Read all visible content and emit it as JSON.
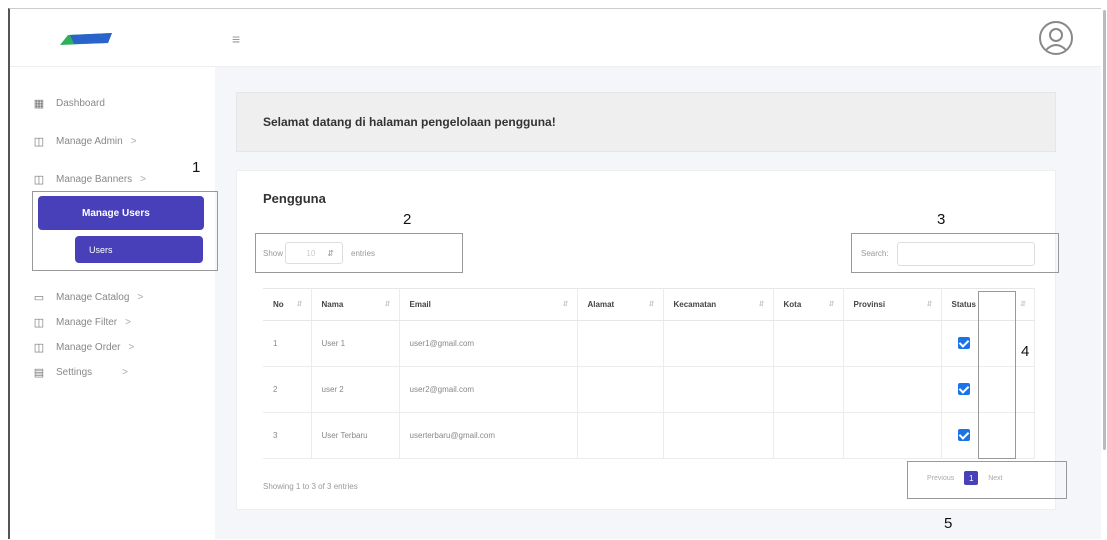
{
  "topbar": {
    "menu_icon": "hamburger-icon",
    "avatar_icon": "user-avatar-icon"
  },
  "sidebar": {
    "items": [
      {
        "label": "Dashboard",
        "icon": "grid-icon",
        "chevron": ""
      },
      {
        "label": "Manage Admin",
        "icon": "table-icon",
        "chevron": ">"
      },
      {
        "label": "Manage Banners",
        "icon": "table-icon",
        "chevron": ">"
      },
      {
        "label": "Manage Users",
        "icon": "table-icon",
        "chevron": ""
      },
      {
        "label": "Users",
        "icon": "",
        "chevron": ""
      },
      {
        "label": "Manage Catalog",
        "icon": "calendar-icon",
        "chevron": ">"
      },
      {
        "label": "Manage Filter",
        "icon": "table-icon",
        "chevron": ">"
      },
      {
        "label": "Manage Order",
        "icon": "table-icon",
        "chevron": ">"
      },
      {
        "label": "Settings",
        "icon": "layout-icon",
        "chevron": ">"
      }
    ]
  },
  "welcome": {
    "text": "Selamat datang di halaman pengelolaan pengguna!"
  },
  "card": {
    "title": "Pengguna",
    "show_label": "Show",
    "entries_value": "10",
    "entries_label": "entries",
    "search_label": "Search:",
    "search_value": ""
  },
  "table": {
    "columns": [
      "No",
      "Nama",
      "Email",
      "Alamat",
      "Kecamatan",
      "Kota",
      "Provinsi",
      "Status"
    ],
    "rows": [
      {
        "no": "1",
        "nama": "User 1",
        "email": "user1@gmail.com",
        "alamat": "",
        "kecamatan": "",
        "kota": "",
        "provinsi": "",
        "status": true
      },
      {
        "no": "2",
        "nama": "user 2",
        "email": "user2@gmail.com",
        "alamat": "",
        "kecamatan": "",
        "kota": "",
        "provinsi": "",
        "status": true
      },
      {
        "no": "3",
        "nama": "User Terbaru",
        "email": "userterbaru@gmail.com",
        "alamat": "",
        "kecamatan": "",
        "kota": "",
        "provinsi": "",
        "status": true
      }
    ]
  },
  "footer": {
    "info": "Showing 1 to 3 of 3 entries",
    "prev": "Previous",
    "page": "1",
    "next": "Next"
  },
  "annotations": [
    "1",
    "2",
    "3",
    "4",
    "5"
  ],
  "colors": {
    "accent": "#4740b8",
    "checkbox": "#1b73e8"
  }
}
